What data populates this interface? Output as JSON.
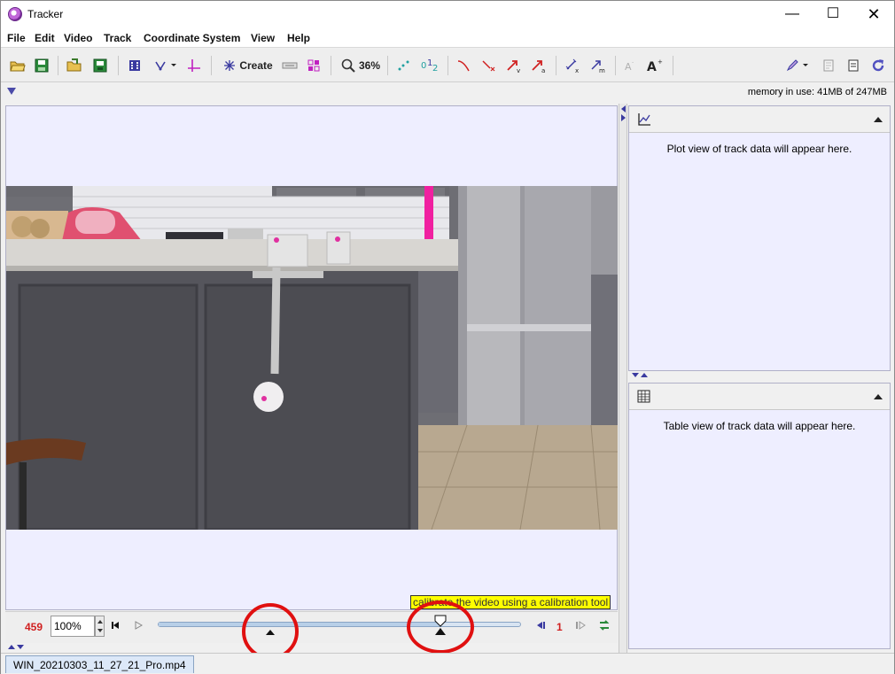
{
  "window": {
    "title": "Tracker",
    "controls": {
      "minimize": "—",
      "maximize": "☐",
      "close": "✕"
    }
  },
  "menu": {
    "items": [
      "File",
      "Edit",
      "Video",
      "Track",
      "Coordinate System",
      "View",
      "Help"
    ]
  },
  "toolbar": {
    "create_label": "Create",
    "zoom_label": "36%",
    "icons": [
      "open-folder-icon",
      "save-icon",
      "open-file-icon",
      "save-tab-icon",
      "clip-settings-icon",
      "calibration-tool-icon",
      "axes-icon",
      "create-track-icon",
      "video-filter-icon",
      "tracks-icon",
      "zoom-icon",
      "trails-icon",
      "labels-icon",
      "path-icon",
      "position-icon",
      "velocity-icon",
      "acceleration-icon",
      "tape-icon",
      "mass-icon",
      "font-smaller-icon",
      "font-larger-icon",
      "pencil-icon",
      "notes-icon",
      "properties-icon",
      "refresh-icon"
    ]
  },
  "status": {
    "memory": "memory in use: 41MB of 247MB"
  },
  "plot_panel": {
    "message": "Plot view of track data will appear here."
  },
  "table_panel": {
    "message": "Table view of track data will appear here."
  },
  "player": {
    "frame_number": "459",
    "rate": "100%",
    "step_number": "1",
    "slider_position": 0.78
  },
  "tooltip": {
    "text": "calibrate the video using a calibration tool"
  },
  "tabs": {
    "video_file": "WIN_20210303_11_27_21_Pro.mp4"
  },
  "colors": {
    "panel_bg": "#eeeeff",
    "accent_red": "#d02020",
    "annotation_red": "#e01010",
    "tooltip_yellow": "#ffff00"
  }
}
